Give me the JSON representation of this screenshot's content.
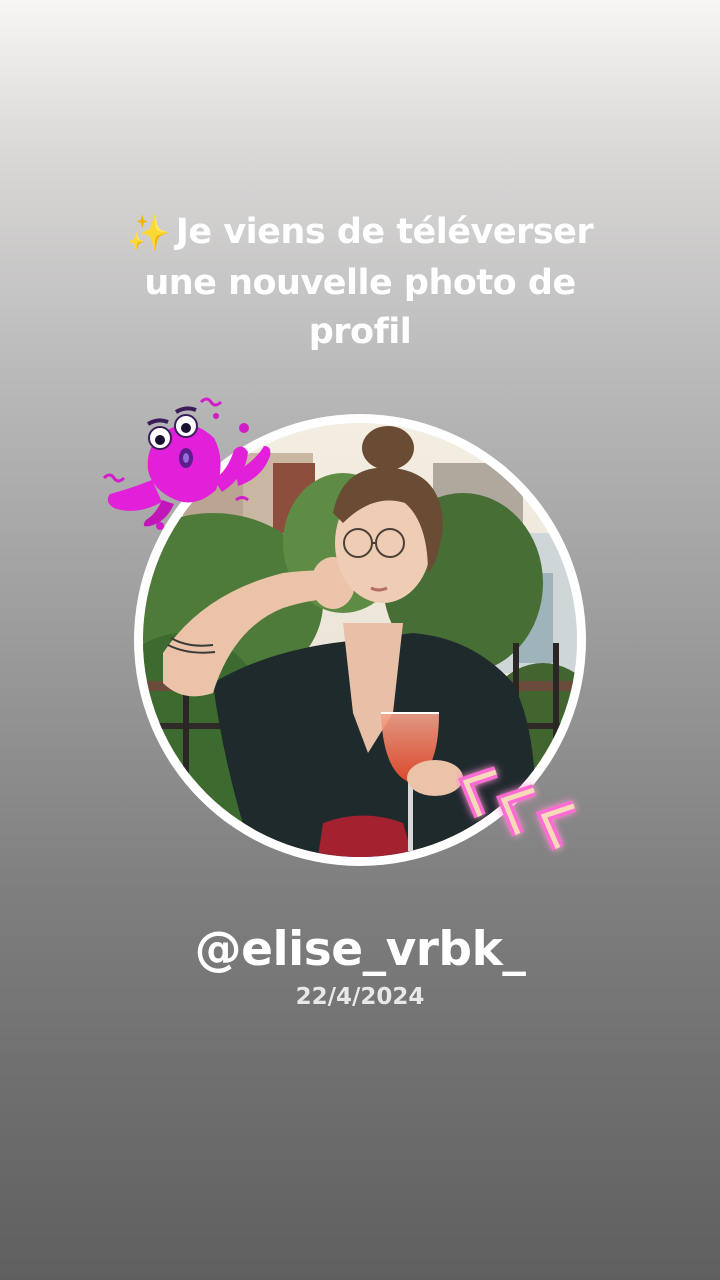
{
  "post": {
    "headline_icon": "sparkles-icon",
    "headline_emoji": "✨",
    "headline": "Je viens de téléverser une nouvelle photo de profil",
    "username": "@elise_vrbk_",
    "date": "22/4/2024"
  },
  "stickers": {
    "top_left": "pink-monster-sticker",
    "bottom_right": "neon-chevrons-sticker"
  },
  "colors": {
    "text": "#ffffff",
    "ring": "#ffffff",
    "sticker_pink": "#e020d8",
    "neon_glow": "#ff6ad5"
  }
}
